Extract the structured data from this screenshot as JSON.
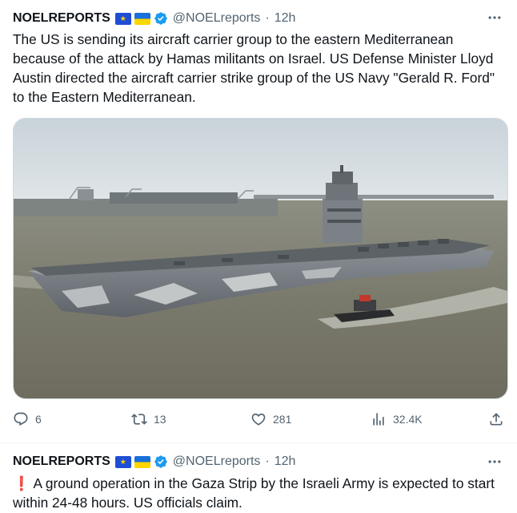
{
  "tweets": [
    {
      "author_name": "NOELREPORTS",
      "badges": [
        "eu-flag-icon",
        "ukraine-flag-icon",
        "verified-badge-icon"
      ],
      "handle": "@NOELreports",
      "separator": "·",
      "time": "12h",
      "text": "The US is sending its aircraft carrier group to the eastern Mediterranean because of the attack by Hamas militants on Israel. US Defense Minister Lloyd Austin directed the aircraft carrier strike group of the US Navy \"Gerald R. Ford\" to the Eastern Mediterranean.",
      "media": "photo of aircraft carrier with tugboat",
      "stats": {
        "replies": "6",
        "retweets": "13",
        "likes": "281",
        "views": "32.4K"
      }
    },
    {
      "author_name": "NOELREPORTS",
      "badges": [
        "eu-flag-icon",
        "ukraine-flag-icon",
        "verified-badge-icon"
      ],
      "handle": "@NOELreports",
      "separator": "·",
      "time": "12h",
      "alert_glyph": "❗",
      "text": "A ground operation in the Gaza Strip by the Israeli Army is expected to start within 24-48 hours. US officials claim."
    }
  ],
  "colors": {
    "text": "#0f1419",
    "secondary": "#536471",
    "verified": "#1d9bf0",
    "border": "#cfd9de"
  }
}
